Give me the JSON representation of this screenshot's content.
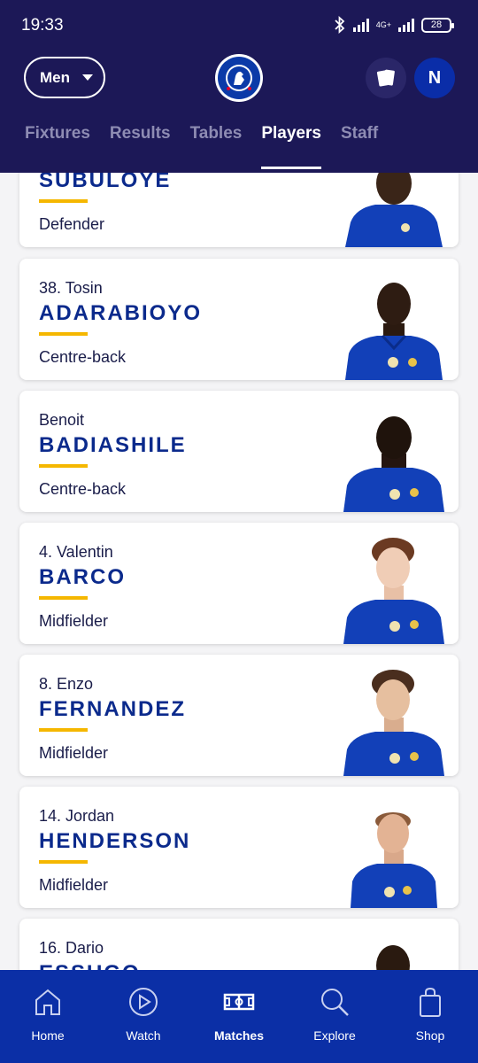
{
  "status_bar": {
    "time": "19:33",
    "network": "4G+",
    "battery": "28"
  },
  "header": {
    "team_select": "Men",
    "avatar_initial": "N",
    "tabs": [
      {
        "label": "Fixtures"
      },
      {
        "label": "Results"
      },
      {
        "label": "Tables"
      },
      {
        "label": "Players"
      },
      {
        "label": "Staff"
      }
    ],
    "active_tab": "Players",
    "crest_text": "CHELSEA FOOTBALL CLUB"
  },
  "players": [
    {
      "first": "",
      "last": "SUBULOYE",
      "position": "Defender"
    },
    {
      "first": "38. Tosin",
      "last": "ADARABIOYO",
      "position": "Centre-back"
    },
    {
      "first": "Benoit",
      "last": "BADIASHILE",
      "position": "Centre-back"
    },
    {
      "first": "4. Valentin",
      "last": "BARCO",
      "position": "Midfielder"
    },
    {
      "first": "8. Enzo",
      "last": "FERNANDEZ",
      "position": "Midfielder"
    },
    {
      "first": "14. Jordan",
      "last": "HENDERSON",
      "position": "Midfielder"
    },
    {
      "first": "16. Dario",
      "last": "ESSUGO",
      "position": ""
    }
  ],
  "bottom_nav": [
    {
      "label": "Home",
      "icon": "home-icon"
    },
    {
      "label": "Watch",
      "icon": "play-icon"
    },
    {
      "label": "Matches",
      "icon": "pitch-icon"
    },
    {
      "label": "Explore",
      "icon": "search-icon"
    },
    {
      "label": "Shop",
      "icon": "bag-icon"
    }
  ],
  "colors": {
    "header_bg": "#1c1857",
    "accent": "#f5b700",
    "brand_blue": "#0b2fa6"
  }
}
